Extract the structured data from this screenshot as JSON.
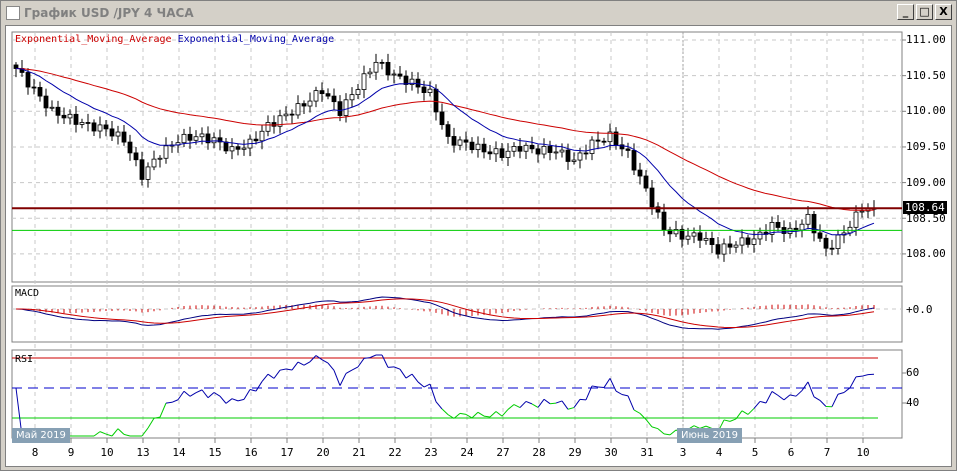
{
  "window": {
    "title": "График USD /JPY  4 ЧАСА",
    "buttons": {
      "minimize": "_",
      "maximize": "□",
      "close": "X"
    }
  },
  "legend": {
    "ema_slow": "Exponential_Moving_Average",
    "ema_fast": "Exponential_Moving_Average"
  },
  "panels": {
    "macd": "MACD",
    "rsi": "RSI"
  },
  "price_axis": [
    "111.00",
    "110.50",
    "110.00",
    "109.50",
    "109.00",
    "108.50",
    "108.00"
  ],
  "current_price": "108.64",
  "macd_axis": [
    "+0.0"
  ],
  "rsi_axis": [
    "60",
    "40"
  ],
  "months": [
    "Май 2019",
    "Июнь 2019"
  ],
  "dates": [
    "8",
    "9",
    "10",
    "13",
    "14",
    "15",
    "16",
    "17",
    "20",
    "21",
    "22",
    "23",
    "24",
    "27",
    "28",
    "29",
    "30",
    "31",
    "3",
    "4",
    "5",
    "6",
    "7",
    "10"
  ],
  "colors": {
    "ema_slow": "#cc0000",
    "ema_fast": "#0000aa",
    "support": "#00cc00",
    "resistance": "#800000"
  },
  "chart_data": {
    "type": "candlestick",
    "symbol": "USD/JPY",
    "timeframe": "4H",
    "closes_half_day": [
      110.6,
      110.3,
      110.0,
      109.9,
      109.8,
      109.75,
      109.6,
      109.1,
      109.4,
      109.6,
      109.65,
      109.6,
      109.45,
      109.55,
      109.8,
      109.95,
      110.1,
      110.3,
      110.0,
      110.35,
      110.7,
      110.5,
      110.4,
      110.25,
      109.6,
      109.55,
      109.45,
      109.4,
      109.5,
      109.45,
      109.45,
      109.3,
      109.55,
      109.65,
      109.4,
      108.9,
      108.35,
      108.25,
      108.25,
      108.05,
      108.15,
      108.2,
      108.4,
      108.3,
      108.5,
      108.05,
      108.3,
      108.64
    ],
    "hlines": {
      "resistance": 108.64,
      "support": 108.33
    },
    "ylim": [
      107.7,
      111.1
    ],
    "rsi_levels": [
      70,
      50,
      30
    ]
  }
}
